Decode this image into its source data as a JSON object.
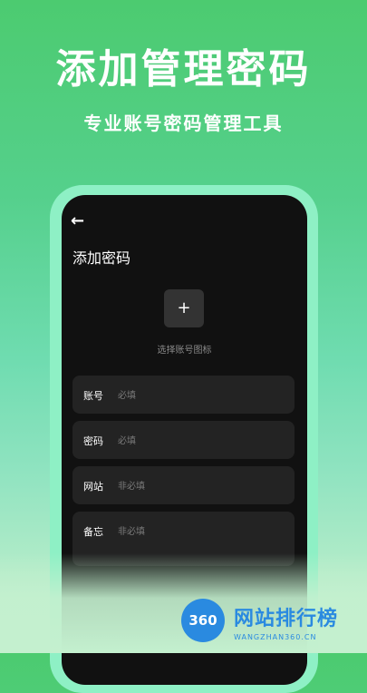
{
  "promo": {
    "headline": "添加管理密码",
    "subheadline": "专业账号密码管理工具"
  },
  "app": {
    "back_icon": "arrow-left-icon",
    "title": "添加密码",
    "add_icon_button": "+",
    "add_icon_caption": "选择账号图标",
    "fields": [
      {
        "label": "账号",
        "placeholder": "必填"
      },
      {
        "label": "密码",
        "placeholder": "必填"
      },
      {
        "label": "网站",
        "placeholder": "非必填"
      },
      {
        "label": "备忘",
        "placeholder": "非必填"
      }
    ]
  },
  "watermark": {
    "badge": "360",
    "name": "网站排行榜",
    "url": "WANGZHAN360.CN"
  },
  "colors": {
    "background_top": "#4ccb70",
    "background_bottom": "#c4f0cf",
    "phone_frame": "#8ef0c5",
    "screen_bg": "#111111",
    "field_bg": "#232323"
  }
}
